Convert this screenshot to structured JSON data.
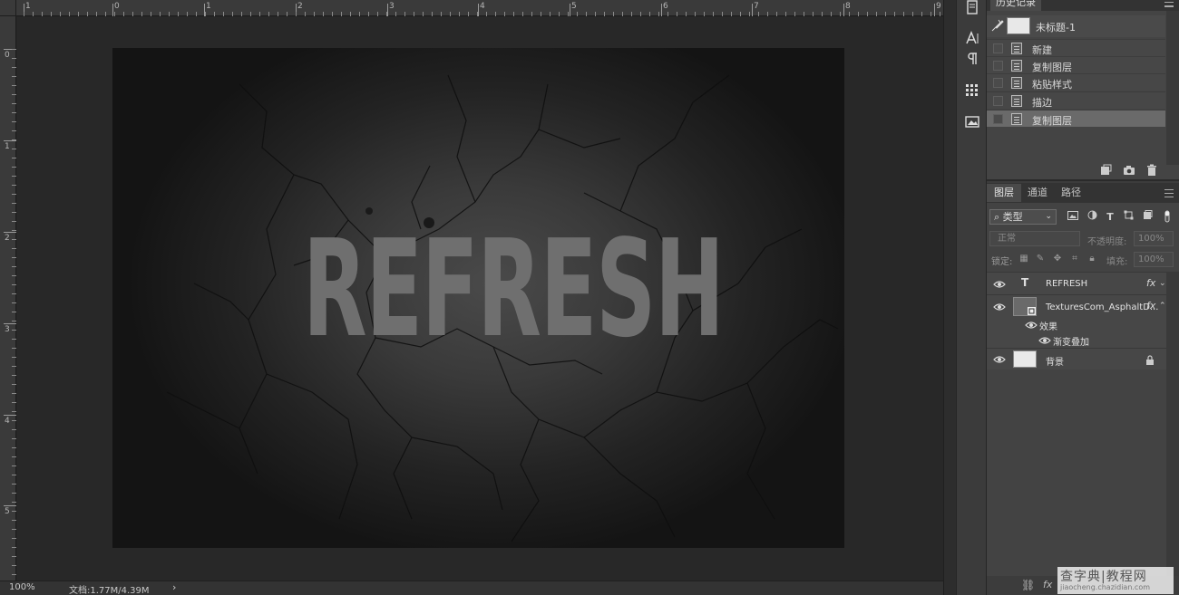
{
  "rulers": {
    "top_labels": [
      "1",
      "0",
      "1",
      "2",
      "3",
      "4",
      "5",
      "6",
      "7",
      "8",
      "9"
    ],
    "left_labels": [
      "0",
      "1",
      "2",
      "3",
      "4",
      "5"
    ]
  },
  "canvas": {
    "text": "REFRESH"
  },
  "status": {
    "zoom": "100%",
    "doc_size": "文档:1.77M/4.39M",
    "arrow": "›"
  },
  "history": {
    "tab_label": "历史记录",
    "snapshot_label": "未标题-1",
    "items": [
      {
        "label": "新建"
      },
      {
        "label": "复制图层"
      },
      {
        "label": "粘贴样式"
      },
      {
        "label": "描边"
      },
      {
        "label": "复制图层"
      }
    ],
    "selected_index": 4
  },
  "layers_panel": {
    "tabs": [
      "图层",
      "通道",
      "路径"
    ],
    "active_tab": "图层",
    "filter_label": "类型",
    "blend_mode": "正常",
    "opacity_label": "不透明度:",
    "opacity_value": "100%",
    "lock_label": "锁定:",
    "fill_label": "填充:",
    "fill_value": "100%",
    "layers": [
      {
        "name": "REFRESH",
        "kind": "text",
        "fx": "fx"
      },
      {
        "name": "TexturesCom_AsphaltD...",
        "kind": "smart-object",
        "fx": "fx"
      },
      {
        "name": "背景",
        "kind": "background",
        "locked": true
      }
    ],
    "effects_label": "效果",
    "effect_item": "渐变叠加"
  },
  "watermark": {
    "big": "查字典|教程网",
    "small": "jiaocheng.chazidian.com"
  },
  "colors": {
    "canvas_text": "#6f6f6f",
    "panel_bg": "#434343",
    "history_selected": "#6a6a6a"
  }
}
